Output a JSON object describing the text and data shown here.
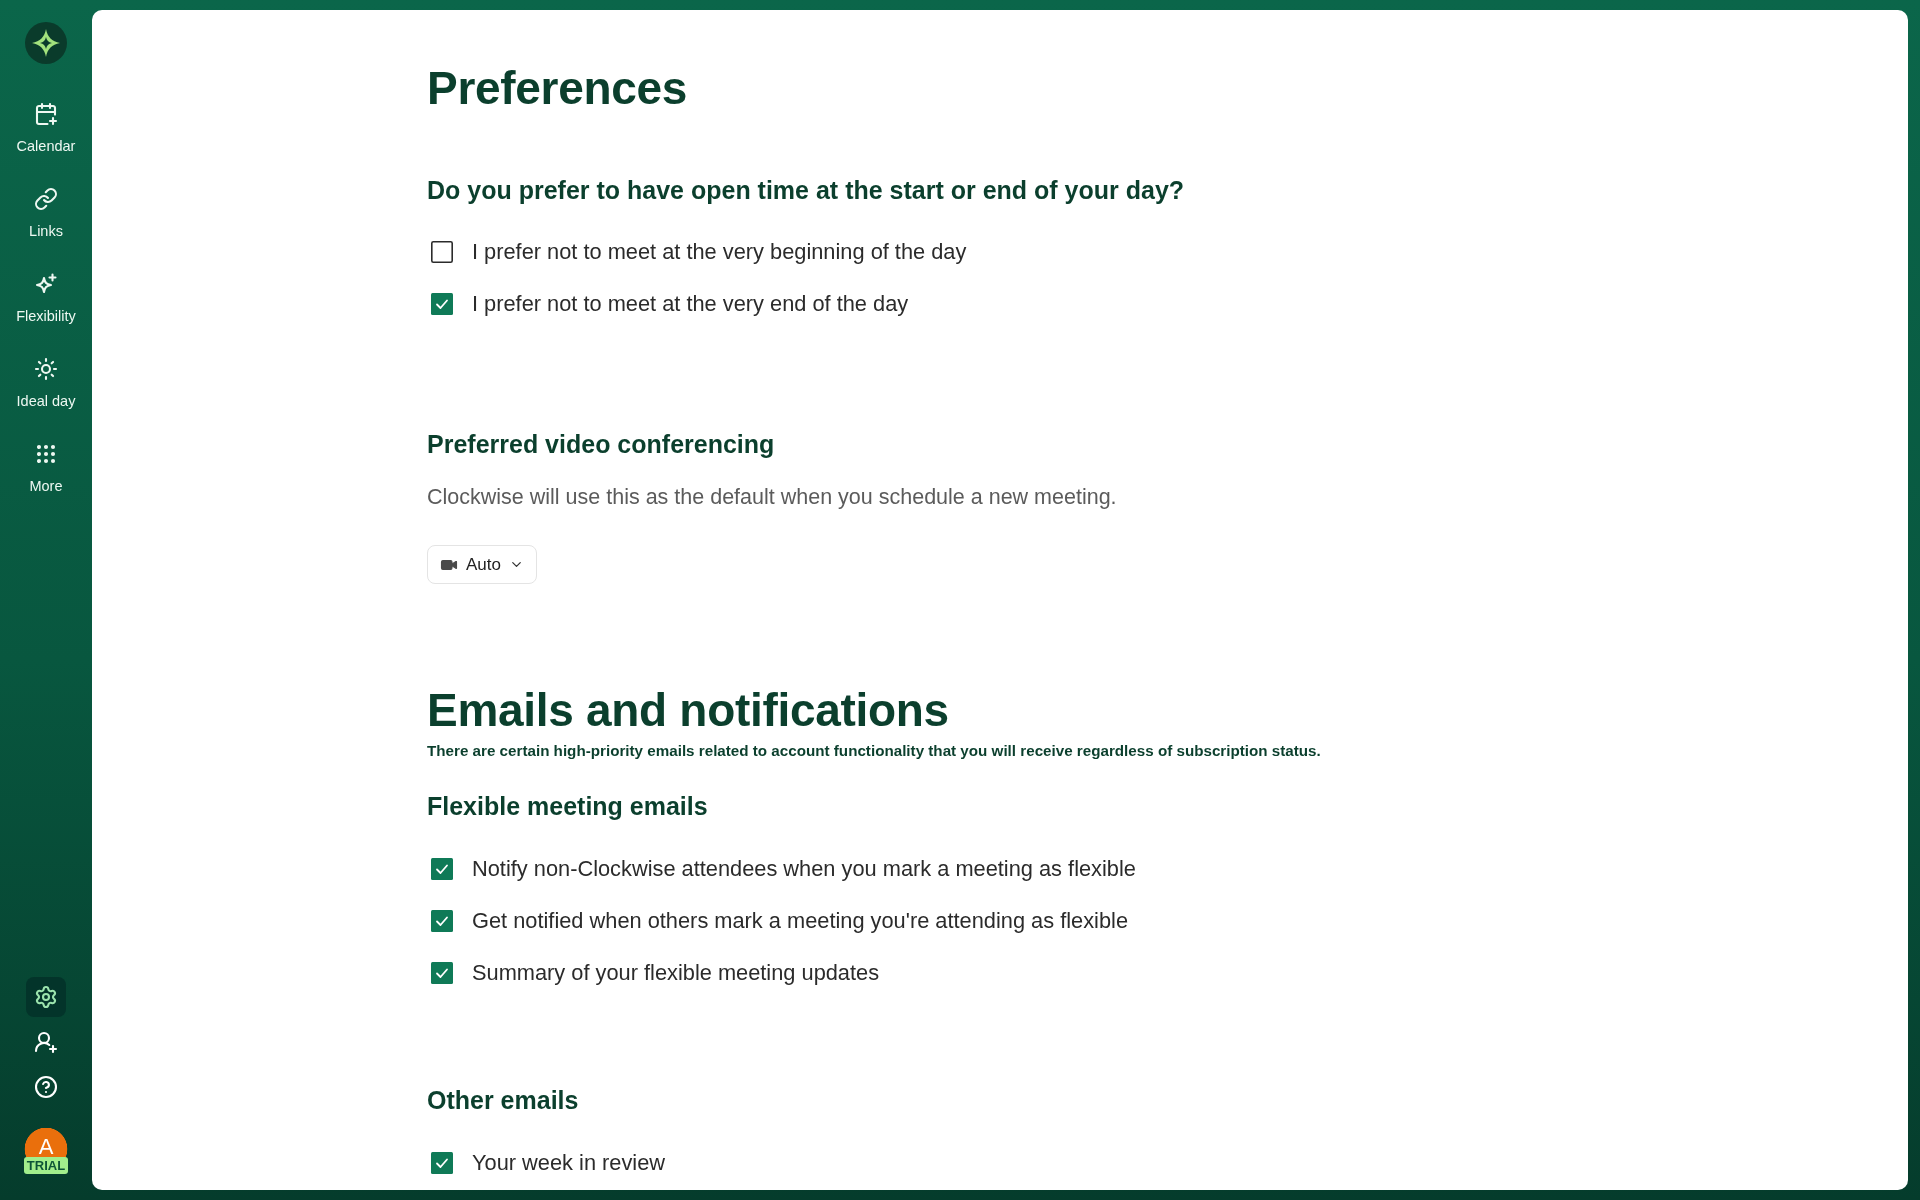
{
  "sidebar": {
    "nav_items": [
      {
        "label": "Calendar",
        "selected": false
      },
      {
        "label": "Links",
        "selected": false
      },
      {
        "label": "Flexibility",
        "selected": false
      },
      {
        "label": "Ideal day",
        "selected": false
      },
      {
        "label": "More",
        "selected": false
      }
    ],
    "utility_buttons": [
      {
        "kind": "settings",
        "selected": true
      },
      {
        "kind": "invite",
        "selected": false
      },
      {
        "kind": "help",
        "selected": false
      }
    ],
    "account": {
      "initial": "A",
      "badge": "TRIAL"
    }
  },
  "preferences": {
    "title": "Preferences",
    "open_time": {
      "heading": "Do you prefer to have open time at the start or end of your day?",
      "options": [
        {
          "label": "I prefer not to meet at the very beginning of the day",
          "checked": false
        },
        {
          "label": "I prefer not to meet at the very end of the day",
          "checked": true
        }
      ]
    },
    "video_conferencing": {
      "heading": "Preferred video conferencing",
      "description": "Clockwise will use this as the default when you schedule a new meeting.",
      "dropdown": {
        "value": "Auto"
      }
    }
  },
  "emails": {
    "title": "Emails and notifications",
    "note": "There are certain high-priority emails related to account functionality that you will receive regardless of subscription status.",
    "groups": [
      {
        "heading": "Flexible meeting emails",
        "options": [
          {
            "label": "Notify non-Clockwise attendees when you mark a meeting as flexible",
            "checked": true
          },
          {
            "label": "Get notified when others mark a meeting you're attending as flexible",
            "checked": true
          },
          {
            "label": "Summary of your flexible meeting updates",
            "checked": true
          }
        ]
      },
      {
        "heading": "Other emails",
        "options": [
          {
            "label": "Your week in review",
            "checked": true
          }
        ]
      }
    ]
  }
}
